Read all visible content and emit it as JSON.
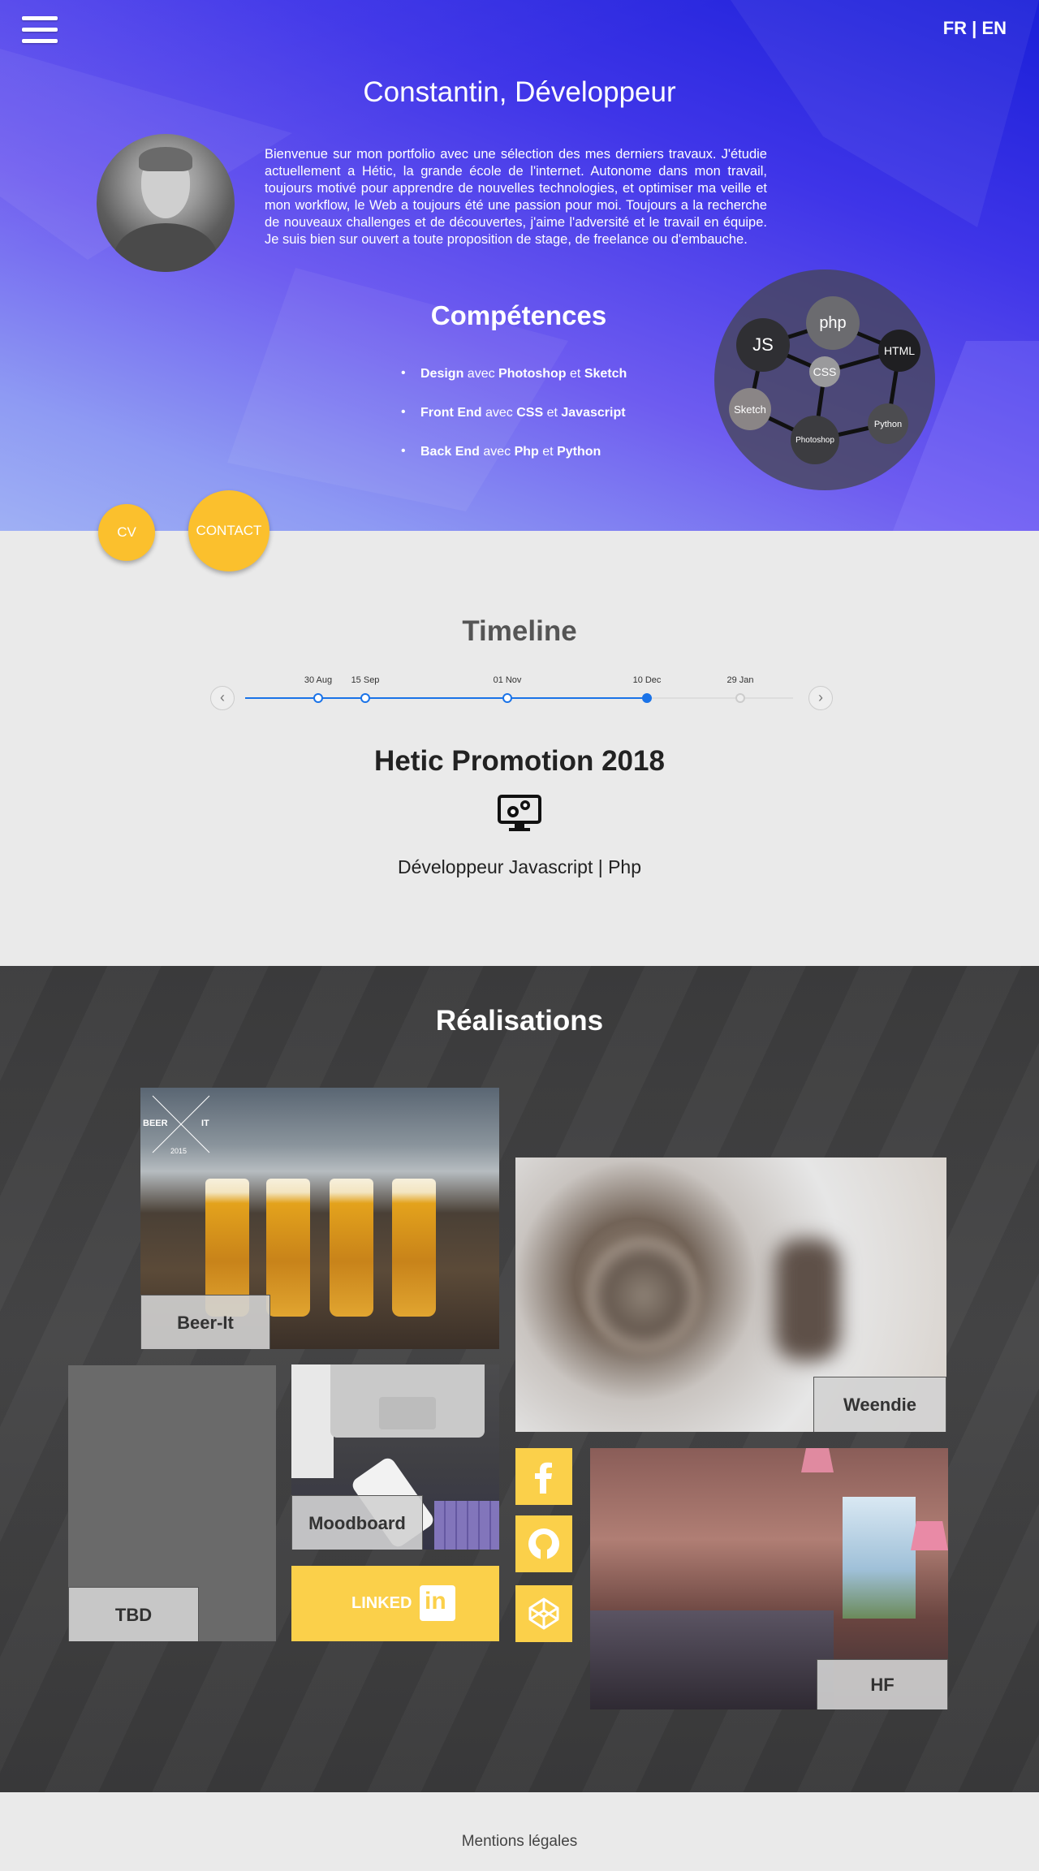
{
  "header": {
    "lang_fr": "FR",
    "lang_sep": " | ",
    "lang_en": "EN"
  },
  "hero": {
    "title": "Constantin, Développeur",
    "bio": "Bienvenue sur mon portfolio avec une sélection des mes derniers travaux. J'étudie actuellement a Hétic, la grande école de l'internet. Autonome dans mon travail, toujours motivé pour apprendre de nouvelles technologies, et optimiser ma veille et mon workflow, le Web a toujours été une passion pour moi. Toujours a la recherche de nouveaux challenges et de découvertes, j'aime l'adversité et le travail en équipe. Je suis bien sur ouvert a toute proposition de stage, de freelance ou d'embauche.",
    "skills_title": "Compétences",
    "skills": [
      {
        "bold1": "Design",
        "mid1": " avec ",
        "bold2": "Photoshop",
        "mid2": " et ",
        "bold3": "Sketch"
      },
      {
        "bold1": "Front End",
        "mid1": " avec ",
        "bold2": "CSS",
        "mid2": " et ",
        "bold3": "Javascript"
      },
      {
        "bold1": "Back End",
        "mid1": " avec ",
        "bold2": "Php",
        "mid2": " et ",
        "bold3": "Python"
      }
    ],
    "bubbles": [
      "php",
      "JS",
      "HTML",
      "CSS",
      "Sketch",
      "Python",
      "Photoshop"
    ],
    "cv_label": "CV",
    "contact_label": "CONTACT",
    "accent": "#fbc02d"
  },
  "timeline": {
    "title": "Timeline",
    "dates": [
      "30 Aug",
      "15 Sep",
      "01 Nov",
      "10 Dec",
      "29 Jan"
    ],
    "active_index": 3,
    "event_title": "Hetic Promotion 2018",
    "event_icon": "computer-gears-icon",
    "event_subtitle": "Développeur Javascript | Php",
    "prev_icon": "chevron-left-icon",
    "next_icon": "chevron-right-icon",
    "line_color": "#1a73e8"
  },
  "realisations": {
    "title": "Réalisations",
    "beer": {
      "label": "Beer-It",
      "logo_left": "BEER",
      "logo_right": "IT",
      "logo_year": "2015"
    },
    "weendie": {
      "label": "Weendie"
    },
    "tbd": {
      "label": "TBD"
    },
    "moodboard": {
      "label": "Moodboard"
    },
    "linkedin": {
      "label": "LINKED",
      "logo": "in"
    },
    "hf": {
      "label": "HF"
    },
    "social": [
      "facebook-icon",
      "github-icon",
      "codepen-icon"
    ],
    "tile_accent": "#fbd04a"
  },
  "footer": {
    "link": "Mentions légales"
  }
}
